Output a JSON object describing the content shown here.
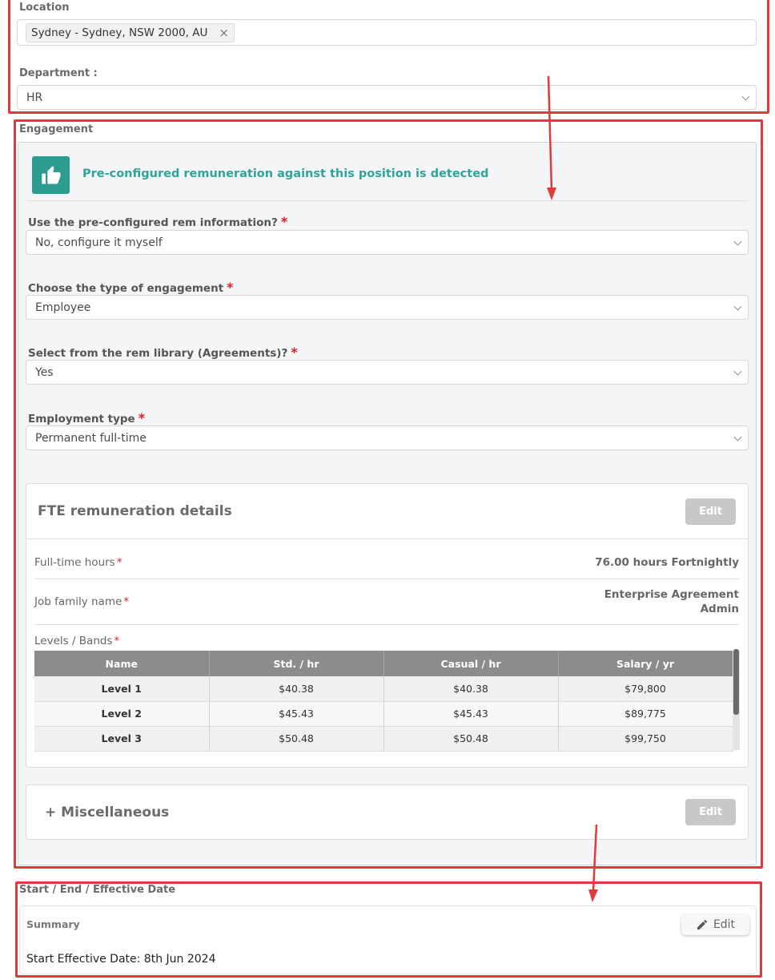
{
  "location": {
    "label": "Location",
    "tag": "Sydney - Sydney, NSW 2000, AU"
  },
  "department": {
    "label": "Department :",
    "value": "HR"
  },
  "engagement": {
    "label": "Engagement",
    "banner": "Pre-configured remuneration against this position is detected",
    "questions": [
      {
        "label": "Use the pre-configured rem information?",
        "value": "No, configure it myself"
      },
      {
        "label": "Choose the type of engagement",
        "value": "Employee"
      },
      {
        "label": "Select from the rem library (Agreements)?",
        "value": "Yes"
      },
      {
        "label": "Employment type",
        "value": "Permanent full-time"
      }
    ],
    "fte": {
      "title": "FTE remuneration details",
      "edit_label": "Edit",
      "full_time_hours_label": "Full-time hours",
      "full_time_hours_value": "76.00 hours Fortnightly",
      "job_family_label": "Job family name",
      "job_family_value_line1": "Enterprise Agreement",
      "job_family_value_line2": "Admin",
      "levels_label": "Levels / Bands",
      "table": {
        "headers": [
          "Name",
          "Std. / hr",
          "Casual / hr",
          "Salary / yr"
        ],
        "rows": [
          [
            "Level 1",
            "$40.38",
            "$40.38",
            "$79,800"
          ],
          [
            "Level 2",
            "$45.43",
            "$45.43",
            "$89,775"
          ],
          [
            "Level 3",
            "$50.48",
            "$50.48",
            "$99,750"
          ]
        ]
      }
    },
    "misc": {
      "title": "+ Miscellaneous",
      "edit_label": "Edit"
    }
  },
  "dates": {
    "label": "Start / End / Effective Date",
    "summary_label": "Summary",
    "edit_label": "Edit",
    "start_text": "Start Effective Date: 8th Jun 2024"
  },
  "colors": {
    "annotation_red": "#e0393e",
    "accent_teal": "#2a9d8f",
    "required_red": "#e01b22"
  }
}
